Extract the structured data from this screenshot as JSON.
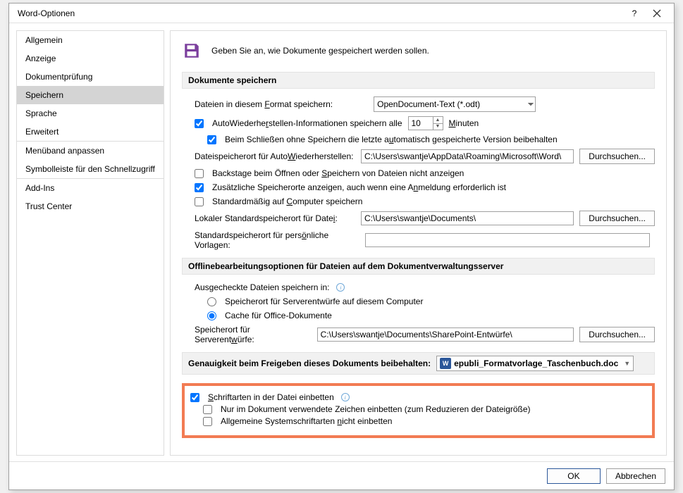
{
  "title": "Word-Optionen",
  "nav": {
    "items": [
      "Allgemein",
      "Anzeige",
      "Dokumentprüfung",
      "Speichern",
      "Sprache",
      "Erweitert",
      "Menüband anpassen",
      "Symbolleiste für den Schnellzugriff",
      "Add-Ins",
      "Trust Center"
    ],
    "active_index": 3
  },
  "header": {
    "text": "Geben Sie an, wie Dokumente gespeichert werden sollen."
  },
  "sections": {
    "save": {
      "title": "Dokumente speichern",
      "format_label": "Dateien in diesem Format speichern:",
      "format_value": "OpenDocument-Text (*.odt)",
      "autorecover_label": "AutoWiederherstellen-Informationen speichern alle",
      "autorecover_value": "10",
      "minutes_label": "Minuten",
      "keep_last_label": "Beim Schließen ohne Speichern die letzte automatisch gespeicherte Version beibehalten",
      "autorecover_path_label": "Dateispeicherort für AutoWiederherstellen:",
      "autorecover_path_value": "C:\\Users\\swantje\\AppData\\Roaming\\Microsoft\\Word\\",
      "browse_label": "Durchsuchen...",
      "no_backstage_label": "Backstage beim Öffnen oder Speichern von Dateien nicht anzeigen",
      "extra_locations_label": "Zusätzliche Speicherorte anzeigen, auch wenn eine Anmeldung erforderlich ist",
      "default_computer_label": "Standardmäßig auf Computer speichern",
      "default_local_label": "Lokaler Standardspeicherort für Datei:",
      "default_local_value": "C:\\Users\\swantje\\Documents\\",
      "personal_templates_label": "Standardspeicherort für persönliche Vorlagen:",
      "personal_templates_value": ""
    },
    "offline": {
      "title": "Offlinebearbeitungsoptionen für Dateien auf dem Dokumentverwaltungsserver",
      "checked_out_label": "Ausgecheckte Dateien speichern in:",
      "radio_server_label": "Speicherort für Serverentwürfe auf diesem Computer",
      "radio_cache_label": "Cache für Office-Dokumente",
      "server_drafts_label": "Speicherort für Serverentwürfe:",
      "server_drafts_value": "C:\\Users\\swantje\\Documents\\SharePoint-Entwürfe\\",
      "browse_label": "Durchsuchen..."
    },
    "fidelity": {
      "title": "Genauigkeit beim Freigeben dieses Dokuments beibehalten:",
      "doc_value": "epubli_Formatvorlage_Taschenbuch.doc",
      "embed_fonts_label": "Schriftarten in der Datei einbetten",
      "only_used_label": "Nur im Dokument verwendete Zeichen einbetten (zum Reduzieren der Dateigröße)",
      "no_system_label": "Allgemeine Systemschriftarten nicht einbetten"
    }
  },
  "footer": {
    "ok": "OK",
    "cancel": "Abbrechen"
  }
}
